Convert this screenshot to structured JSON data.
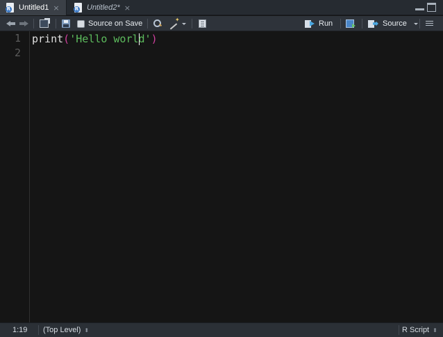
{
  "tabs": [
    {
      "label": "Untitled1",
      "close": "×",
      "active": true
    },
    {
      "label": "Untitled2*",
      "close": "×",
      "active": false
    }
  ],
  "toolbar": {
    "source_on_save": "Source on Save",
    "run": "Run",
    "source": "Source"
  },
  "editor": {
    "line_numbers": [
      "1",
      "2"
    ],
    "code": {
      "fn": "print",
      "open_paren": "(",
      "string_before_cursor": "'Hello worl",
      "string_after_cursor": "d'",
      "close_paren": ")"
    }
  },
  "statusbar": {
    "cursor_position": "1:19",
    "scope": "(Top Level)",
    "file_type": "R Script"
  },
  "colors": {
    "string": "#5dbb5d",
    "paren": "#d1409e",
    "editor_bg": "#151515"
  }
}
